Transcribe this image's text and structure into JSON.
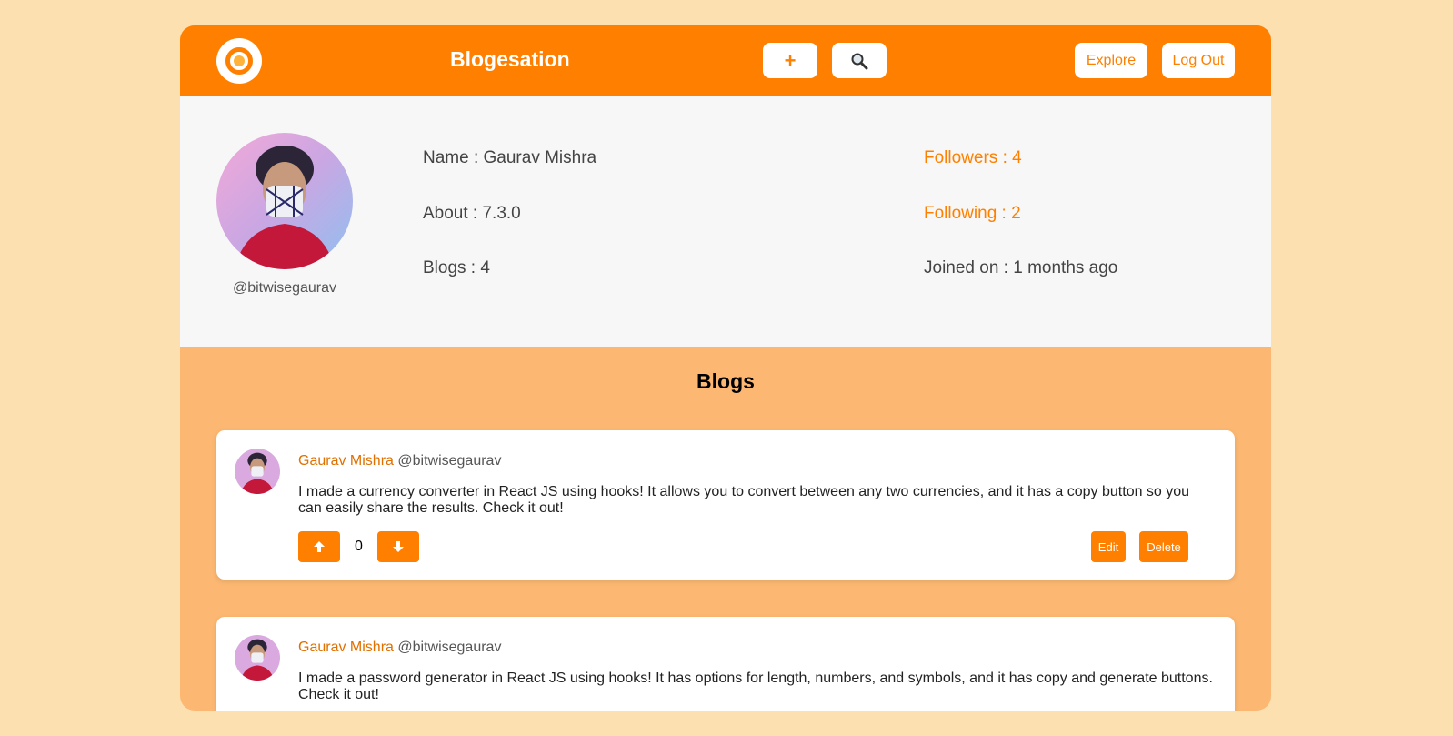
{
  "navbar": {
    "brand": "Blogesation",
    "add_label": "+",
    "explore_label": "Explore",
    "logout_label": "Log Out"
  },
  "profile": {
    "handle": "@bitwisegaurav",
    "name": "Name : Gaurav Mishra",
    "about": "About : 7.3.0",
    "blogs": "Blogs : 4",
    "followers": "Followers : 4",
    "following": "Following : 2",
    "joined": "Joined on : 1 months ago"
  },
  "blogs_section": {
    "title": "Blogs",
    "posts": [
      {
        "author": "Gaurav Mishra",
        "handle": "@bitwisegaurav",
        "content": "I made a currency converter in React JS using hooks! It allows you to convert between any two currencies, and it has a copy button so you can easily share the results. Check it out!",
        "votes": "0",
        "edit_label": "Edit",
        "delete_label": "Delete"
      },
      {
        "author": "Gaurav Mishra",
        "handle": "@bitwisegaurav",
        "content": "I made a password generator in React JS using hooks! It has options for length, numbers, and symbols, and it has copy and generate buttons. Check it out!"
      }
    ]
  },
  "colors": {
    "accent": "#ff8000",
    "page_bg": "#fde0b0",
    "section_bg": "#fcb872"
  }
}
